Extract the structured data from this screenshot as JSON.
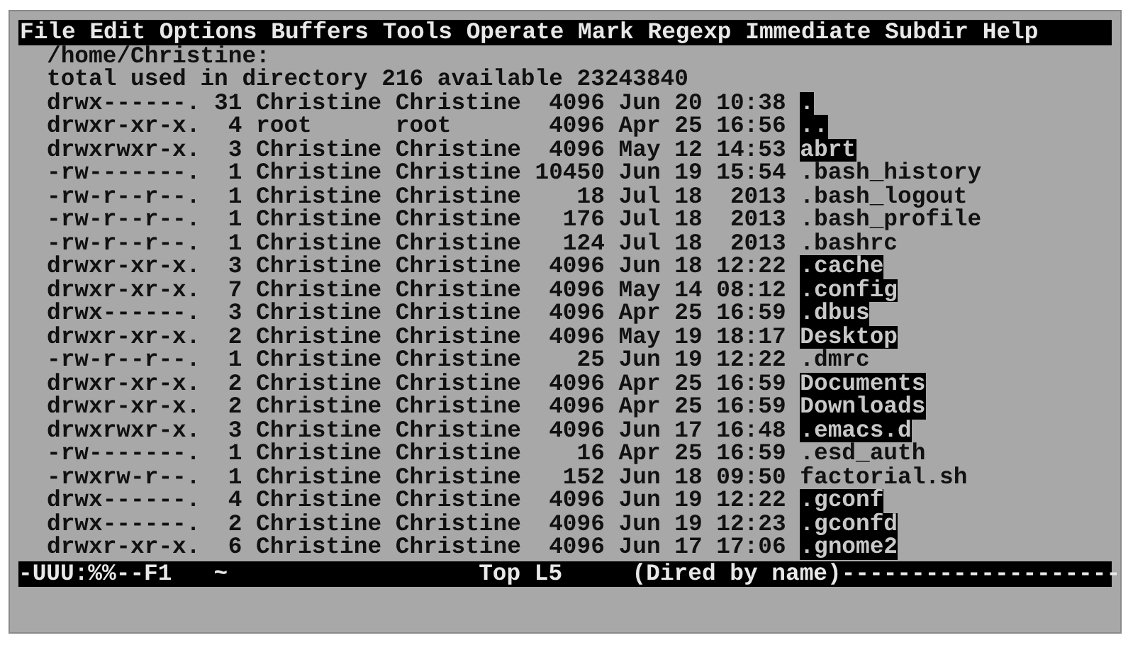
{
  "menu_bar": [
    "File",
    "Edit",
    "Options",
    "Buffers",
    "Tools",
    "Operate",
    "Mark",
    "Regexp",
    "Immediate",
    "Subdir",
    "Help"
  ],
  "header": {
    "path": "/home/Christine:",
    "summary": "total used in directory 216 available 23243840"
  },
  "entries": [
    {
      "info": "drwx------. 31 Christine Christine  4096 Jun 20 10:38",
      "name": ".",
      "highlighted": true
    },
    {
      "info": "drwxr-xr-x.  4 root      root       4096 Apr 25 16:56",
      "name": "..",
      "highlighted": true
    },
    {
      "info": "drwxrwxr-x.  3 Christine Christine  4096 May 12 14:53",
      "name": "abrt",
      "highlighted": true
    },
    {
      "info": "-rw-------.  1 Christine Christine 10450 Jun 19 15:54",
      "name": ".bash_history",
      "highlighted": false
    },
    {
      "info": "-rw-r--r--.  1 Christine Christine    18 Jul 18  2013",
      "name": ".bash_logout",
      "highlighted": false
    },
    {
      "info": "-rw-r--r--.  1 Christine Christine   176 Jul 18  2013",
      "name": ".bash_profile",
      "highlighted": false
    },
    {
      "info": "-rw-r--r--.  1 Christine Christine   124 Jul 18  2013",
      "name": ".bashrc",
      "highlighted": false
    },
    {
      "info": "drwxr-xr-x.  3 Christine Christine  4096 Jun 18 12:22",
      "name": ".cache",
      "highlighted": true
    },
    {
      "info": "drwxr-xr-x.  7 Christine Christine  4096 May 14 08:12",
      "name": ".config",
      "highlighted": true
    },
    {
      "info": "drwx------.  3 Christine Christine  4096 Apr 25 16:59",
      "name": ".dbus",
      "highlighted": true
    },
    {
      "info": "drwxr-xr-x.  2 Christine Christine  4096 May 19 18:17",
      "name": "Desktop",
      "highlighted": true
    },
    {
      "info": "-rw-r--r--.  1 Christine Christine    25 Jun 19 12:22",
      "name": ".dmrc",
      "highlighted": false
    },
    {
      "info": "drwxr-xr-x.  2 Christine Christine  4096 Apr 25 16:59",
      "name": "Documents",
      "highlighted": true
    },
    {
      "info": "drwxr-xr-x.  2 Christine Christine  4096 Apr 25 16:59",
      "name": "Downloads",
      "highlighted": true
    },
    {
      "info": "drwxrwxr-x.  3 Christine Christine  4096 Jun 17 16:48",
      "name": ".emacs.d",
      "highlighted": true
    },
    {
      "info": "-rw-------.  1 Christine Christine    16 Apr 25 16:59",
      "name": ".esd_auth",
      "highlighted": false
    },
    {
      "info": "-rwxrw-r--.  1 Christine Christine   152 Jun 18 09:50",
      "name": "factorial.sh",
      "highlighted": false
    },
    {
      "info": "drwx------.  4 Christine Christine  4096 Jun 19 12:22",
      "name": ".gconf",
      "highlighted": true
    },
    {
      "info": "drwx------.  2 Christine Christine  4096 Jun 19 12:23",
      "name": ".gconfd",
      "highlighted": true
    },
    {
      "info": "drwxr-xr-x.  6 Christine Christine  4096 Jun 17 17:06",
      "name": ".gnome2",
      "highlighted": true
    }
  ],
  "mode_line": "-UUU:%%--F1   ~                  Top L5     (Dired by name)--------------------"
}
